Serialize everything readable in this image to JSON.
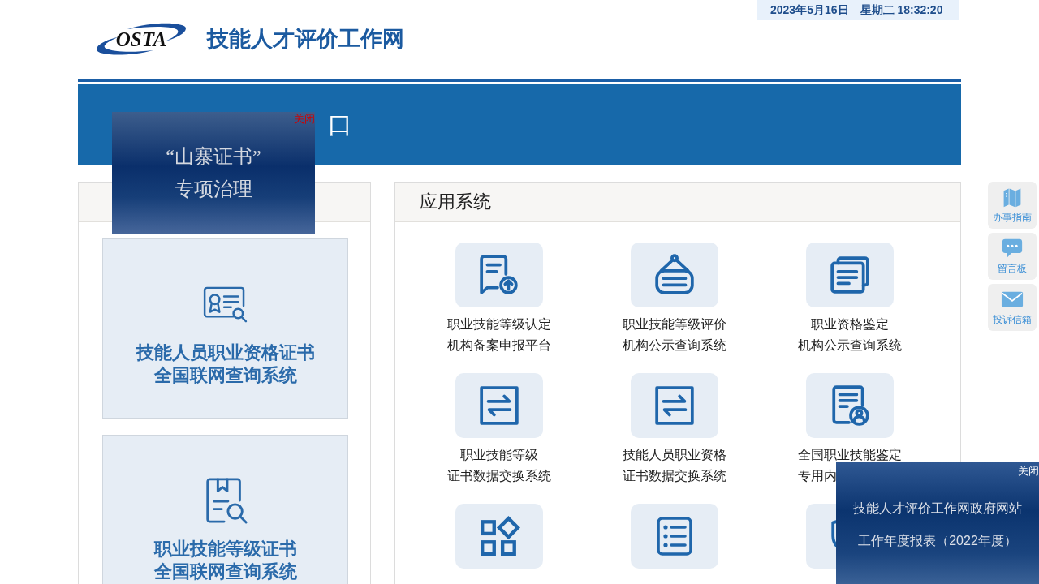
{
  "header": {
    "logo_text": "OSTA",
    "site_title": "技能人才评价工作网",
    "date": "2023年5月16日",
    "weekday_time": "星期二 18:32:20"
  },
  "banner": {
    "title": "口"
  },
  "left_panel": {
    "cards": [
      {
        "kind": "certificate",
        "lines": [
          "技能人员职业资格证书",
          "全国联网查询系统"
        ]
      },
      {
        "kind": "document",
        "lines": [
          "职业技能等级证书",
          "全国联网查询系统"
        ]
      }
    ]
  },
  "apps_panel": {
    "title": "应用系统",
    "apps": [
      {
        "kind": "upload",
        "lines": [
          "职业技能等级认定",
          "机构备案申报平台"
        ]
      },
      {
        "kind": "sign",
        "lines": [
          "职业技能等级评价",
          "机构公示查询系统"
        ]
      },
      {
        "kind": "documents",
        "lines": [
          "职业资格鉴定",
          "机构公示查询系统"
        ]
      },
      {
        "kind": "exchange",
        "lines": [
          "职业技能等级",
          "证书数据交换系统"
        ]
      },
      {
        "kind": "exchange",
        "lines": [
          "技能人员职业资格",
          "证书数据交换系统"
        ]
      },
      {
        "kind": "person",
        "lines": [
          "全国职业技能鉴定",
          "专用内"
        ]
      },
      {
        "kind": "grid"
      },
      {
        "kind": "list"
      },
      {
        "kind": "shield"
      }
    ]
  },
  "side_buttons": [
    {
      "kind": "map",
      "label": "办事指南"
    },
    {
      "kind": "chat",
      "label": "留言板"
    },
    {
      "kind": "mail",
      "label": "投诉信箱"
    }
  ],
  "popups": [
    {
      "lines": [
        "“山寨证书”",
        "专项治理"
      ],
      "close": "关闭"
    },
    {
      "lines": [
        "技能人才评价工作网政府网站",
        "工作年度报表（2022年度）"
      ],
      "close": "关闭"
    }
  ]
}
